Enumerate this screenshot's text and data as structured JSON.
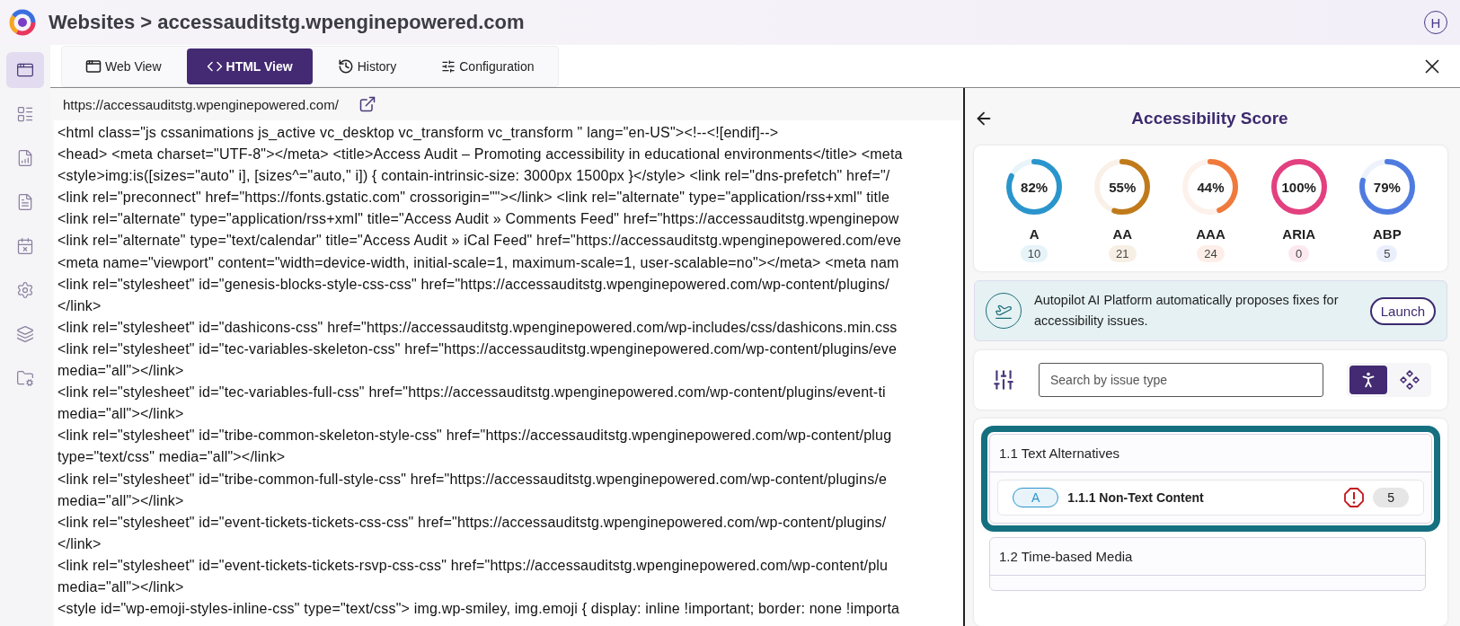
{
  "header": {
    "breadcrumb": "Websites > accessauditstg.wpenginepowered.com",
    "avatar": "H"
  },
  "sidebar": {
    "items": [
      {
        "selected": true
      },
      {
        "selected": false
      },
      {
        "selected": false
      },
      {
        "selected": false
      },
      {
        "selected": false
      },
      {
        "selected": false
      },
      {
        "selected": false
      },
      {
        "selected": false
      }
    ]
  },
  "tabs": [
    {
      "label": "Web View",
      "selected": false
    },
    {
      "label": "HTML View",
      "selected": true
    },
    {
      "label": "History",
      "selected": false
    },
    {
      "label": "Configuration",
      "selected": false
    }
  ],
  "url": "https://accessauditstg.wpenginepowered.com/",
  "code_lines": [
    "<html class=\"js cssanimations js_active vc_desktop vc_transform vc_transform \" lang=\"en-US\"><!--<![endif]-->",
    "<head> <meta charset=\"UTF-8\"></meta> <title>Access Audit – Promoting accessibility in educational environments</title> <meta",
    "<style>img:is([sizes=\"auto\" i], [sizes^=\"auto,\" i]) { contain-intrinsic-size: 3000px 1500px }</style> <link rel=\"dns-prefetch\" href=\"/",
    "<link rel=\"preconnect\" href=\"https://fonts.gstatic.com\" crossorigin=\"\"></link> <link rel=\"alternate\" type=\"application/rss+xml\" title",
    "<link rel=\"alternate\" type=\"application/rss+xml\" title=\"Access Audit » Comments Feed\" href=\"https://accessauditstg.wpenginepow",
    "<link rel=\"alternate\" type=\"text/calendar\" title=\"Access Audit » iCal Feed\" href=\"https://accessauditstg.wpenginepowered.com/eve",
    "<meta name=\"viewport\" content=\"width=device-width, initial-scale=1, maximum-scale=1, user-scalable=no\"></meta> <meta nam",
    "<link rel=\"stylesheet\" id=\"genesis-blocks-style-css-css\" href=\"https://accessauditstg.wpenginepowered.com/wp-content/plugins/",
    "</link>",
    "<link rel=\"stylesheet\" id=\"dashicons-css\" href=\"https://accessauditstg.wpenginepowered.com/wp-includes/css/dashicons.min.css",
    "<link rel=\"stylesheet\" id=\"tec-variables-skeleton-css\" href=\"https://accessauditstg.wpenginepowered.com/wp-content/plugins/eve",
    "media=\"all\"></link>",
    "<link rel=\"stylesheet\" id=\"tec-variables-full-css\" href=\"https://accessauditstg.wpenginepowered.com/wp-content/plugins/event-ti",
    "media=\"all\"></link>",
    "<link rel=\"stylesheet\" id=\"tribe-common-skeleton-style-css\" href=\"https://accessauditstg.wpenginepowered.com/wp-content/plug",
    "type=\"text/css\" media=\"all\"></link>",
    "<link rel=\"stylesheet\" id=\"tribe-common-full-style-css\" href=\"https://accessauditstg.wpenginepowered.com/wp-content/plugins/e",
    "media=\"all\"></link>",
    "<link rel=\"stylesheet\" id=\"event-tickets-tickets-css-css\" href=\"https://accessauditstg.wpenginepowered.com/wp-content/plugins/",
    "</link>",
    "<link rel=\"stylesheet\" id=\"event-tickets-tickets-rsvp-css-css\" href=\"https://accessauditstg.wpenginepowered.com/wp-content/plu",
    "media=\"all\"></link>",
    "<style id=\"wp-emoji-styles-inline-css\" type=\"text/css\"> img.wp-smiley, img.emoji { display: inline !important; border: none !importa"
  ],
  "score_panel": {
    "title": "Accessibility Score",
    "gauges": [
      {
        "percent": "82%",
        "label": "A",
        "count": "10",
        "level": 0.82,
        "color": "#2a95cc"
      },
      {
        "percent": "55%",
        "label": "AA",
        "count": "21",
        "level": 0.55,
        "color": "#c07a1a"
      },
      {
        "percent": "44%",
        "label": "AAA",
        "count": "24",
        "level": 0.44,
        "color": "#ef7a3c"
      },
      {
        "percent": "100%",
        "label": "ARIA",
        "count": "0",
        "level": 1,
        "color": "#e2407f"
      },
      {
        "percent": "79%",
        "label": "ABP",
        "count": "5",
        "level": 0.79,
        "color": "#4f7be0"
      }
    ],
    "banner": {
      "text": "Autopilot AI Platform automatically proposes fixes for accessibility issues.",
      "button": "Launch"
    },
    "search": {
      "placeholder": "Search by issue type"
    },
    "view_toggle": [
      {
        "selected": true
      },
      {
        "selected": false
      }
    ],
    "groups": [
      {
        "title": "1.1 Text Alternatives",
        "highlighted": true,
        "criteria": [
          {
            "level": "A",
            "title": "1.1.1 Non-Text Content",
            "count": "5"
          }
        ]
      },
      {
        "title": "1.2 Time-based Media",
        "highlighted": false
      }
    ]
  }
}
